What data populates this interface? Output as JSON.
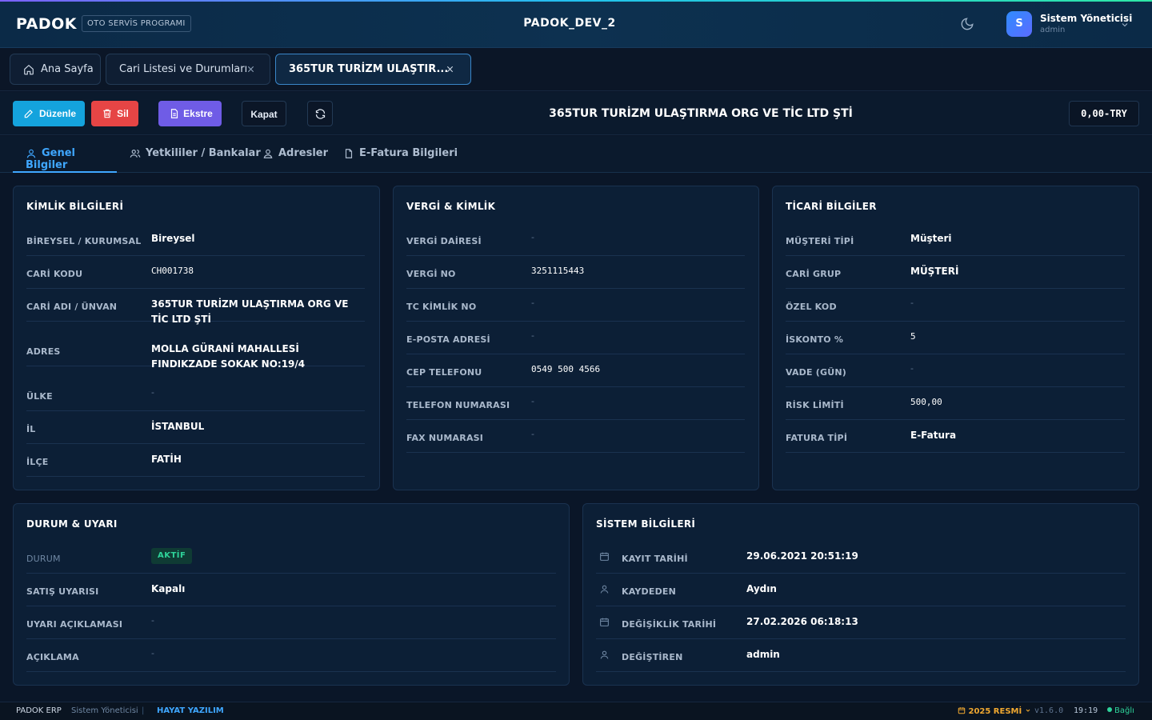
{
  "header": {
    "logo": "PADOK",
    "product_badge": "OTO SERVİS PROGRAMI",
    "app_title": "PADOK_DEV_2",
    "user": {
      "initial": "S",
      "name": "Sistem Yöneticisi",
      "role": "admin"
    }
  },
  "tabs": [
    {
      "label": "Ana Sayfa",
      "icon": "home-icon"
    },
    {
      "label": "Cari Listesi ve Durumları",
      "closable": true
    },
    {
      "label": "365TUR TURİZM ULAŞTIR...",
      "closable": true,
      "active": true
    }
  ],
  "toolbar": {
    "edit_label": "Düzenle",
    "delete_label": "Sil",
    "statement_label": "Ekstre",
    "close_label": "Kapat",
    "record_title": "365TUR TURİZM ULAŞTIRMA ORG VE TİC LTD ŞTİ",
    "balance": "0,00-TRY",
    "colors": {
      "edit": "#14a3dd",
      "delete": "#e64545",
      "statement": "#6f5ce6"
    }
  },
  "subtabs": [
    {
      "label": "Genel Bilgiler",
      "icon": "user-icon",
      "active": true
    },
    {
      "label": "Yetkililer / Bankalar",
      "icon": "users-icon"
    },
    {
      "label": "Adresler",
      "icon": "location-user-icon"
    },
    {
      "label": "E-Fatura Bilgileri",
      "icon": "document-icon"
    }
  ],
  "identity": {
    "title": "KİMLİK BİLGİLERİ",
    "rows": [
      {
        "label": "BİREYSEL / KURUMSAL",
        "value": "Bireysel"
      },
      {
        "label": "CARİ KODU",
        "value": "CH001738"
      },
      {
        "label": "CARİ ADI / ÜNVAN",
        "value": "365TUR TURİZM ULAŞTIRMA ORG VE TİC LTD ŞTİ"
      },
      {
        "label": "ADRES",
        "value": "MOLLA GÜRANİ MAHALLESİ FINDIKZADE SOKAK NO:19/4"
      },
      {
        "label": "ÜLKE",
        "value": "-"
      },
      {
        "label": "İL",
        "value": "İSTANBUL"
      },
      {
        "label": "İLÇE",
        "value": "FATİH"
      }
    ]
  },
  "tax": {
    "title": "VERGİ & KİMLİK",
    "rows": [
      {
        "label": "VERGİ DAİRESİ",
        "value": "-"
      },
      {
        "label": "VERGİ NO",
        "value": "3251115443"
      },
      {
        "label": "TC KİMLİK NO",
        "value": "-"
      },
      {
        "label": "E-POSTA ADRESİ",
        "value": "-"
      },
      {
        "label": "CEP TELEFONU",
        "value": "0549 500 4566"
      },
      {
        "label": "TELEFON NUMARASI",
        "value": "-"
      },
      {
        "label": "FAX NUMARASI",
        "value": "-"
      }
    ]
  },
  "commercial": {
    "title": "TİCARİ BİLGİLER",
    "rows": [
      {
        "label": "MÜŞTERİ TİPİ",
        "value": "Müşteri"
      },
      {
        "label": "CARİ GRUP",
        "value": "MÜŞTERİ"
      },
      {
        "label": "ÖZEL KOD",
        "value": "-"
      },
      {
        "label": "İSKONTO %",
        "value": "5"
      },
      {
        "label": "VADE (GÜN)",
        "value": "-"
      },
      {
        "label": "RİSK LİMİTİ",
        "value": "500,00"
      },
      {
        "label": "FATURA TİPİ",
        "value": "E-Fatura"
      }
    ]
  },
  "status": {
    "title": "DURUM & UYARI",
    "rows": [
      {
        "label": "DURUM",
        "value": "AKTİF"
      },
      {
        "label": "SATIŞ UYARISI",
        "value": "Kapalı"
      },
      {
        "label": "UYARI AÇIKLAMASI",
        "value": "-"
      },
      {
        "label": "AÇIKLAMA",
        "value": "-"
      }
    ],
    "badge_color": "#2ed39a"
  },
  "system": {
    "title": "SİSTEM BİLGİLERİ",
    "rows": [
      {
        "label": "KAYIT TARİHİ",
        "value": "29.06.2021 20:51:19",
        "icon": "calendar-icon"
      },
      {
        "label": "KAYDEDEN",
        "value": "Aydın",
        "icon": "user-icon"
      },
      {
        "label": "DEĞİŞİKLİK TARİHİ",
        "value": "27.02.2026 06:18:13",
        "icon": "calendar-icon"
      },
      {
        "label": "DEĞİŞTİREN",
        "value": "admin",
        "icon": "user-icon"
      }
    ]
  },
  "statusbar": {
    "app": "PADOK ERP",
    "user": "Sistem Yöneticisi",
    "separator": "|",
    "company": "HAYAT YAZILIM",
    "period": "2025 RESMİ",
    "version": "v1.6.0",
    "time": "19:19",
    "connection": "Bağlı"
  }
}
